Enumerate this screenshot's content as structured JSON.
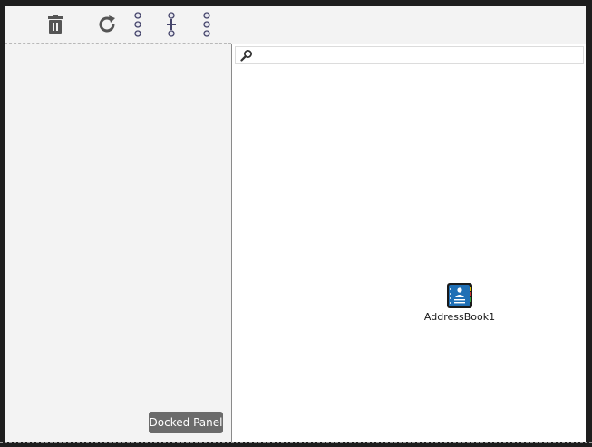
{
  "toolbar": {
    "buttons": [
      {
        "name": "delete",
        "icon": "trash-icon"
      },
      {
        "name": "refresh",
        "icon": "refresh-icon"
      },
      {
        "name": "column-layout",
        "icon": "vertical-dots-icon"
      },
      {
        "name": "add-item",
        "icon": "plus-dots-icon"
      },
      {
        "name": "more-options",
        "icon": "vertical-dots-icon"
      }
    ]
  },
  "left_panel": {
    "docked_label": "Docked Panel"
  },
  "search": {
    "value": "",
    "placeholder": ""
  },
  "items": [
    {
      "label": "AddressBook1",
      "icon": "address-book-icon"
    }
  ],
  "colors": {
    "window_border": "#1e1e1e",
    "panel_background": "#f3f3f3",
    "content_background": "#ffffff",
    "docked_button": "#6b6b6b",
    "icon_gray": "#555555",
    "address_book_blue": "#1f6fb5"
  }
}
